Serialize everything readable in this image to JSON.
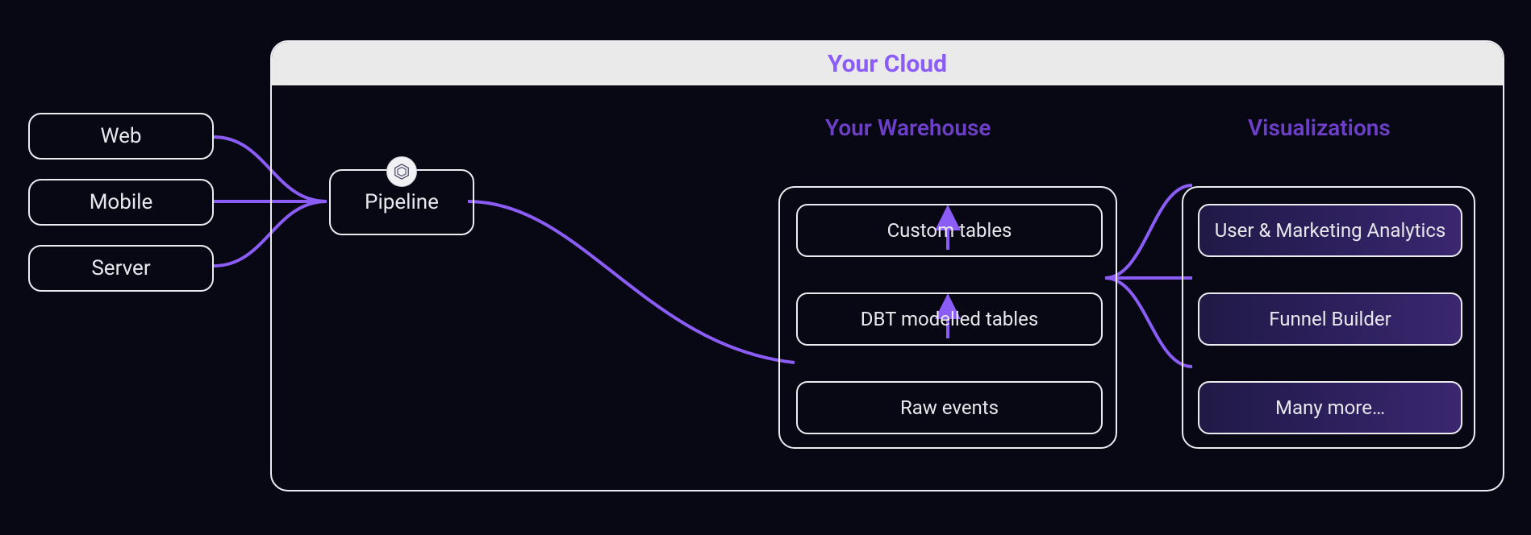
{
  "sources": {
    "web": "Web",
    "mobile": "Mobile",
    "server": "Server"
  },
  "cloud": {
    "title": "Your Cloud",
    "pipeline_label": "Pipeline",
    "warehouse": {
      "title": "Your Warehouse",
      "custom_tables": "Custom tables",
      "dbt_tables": "DBT modelled tables",
      "raw_events": "Raw events"
    },
    "visualizations": {
      "title": "Visualizations",
      "items": [
        "User & Marketing Analytics",
        "Funnel Builder",
        "Many more…"
      ]
    }
  },
  "colors": {
    "accent": "#8b5cf6",
    "border": "#ececf0",
    "bg": "#070814"
  }
}
